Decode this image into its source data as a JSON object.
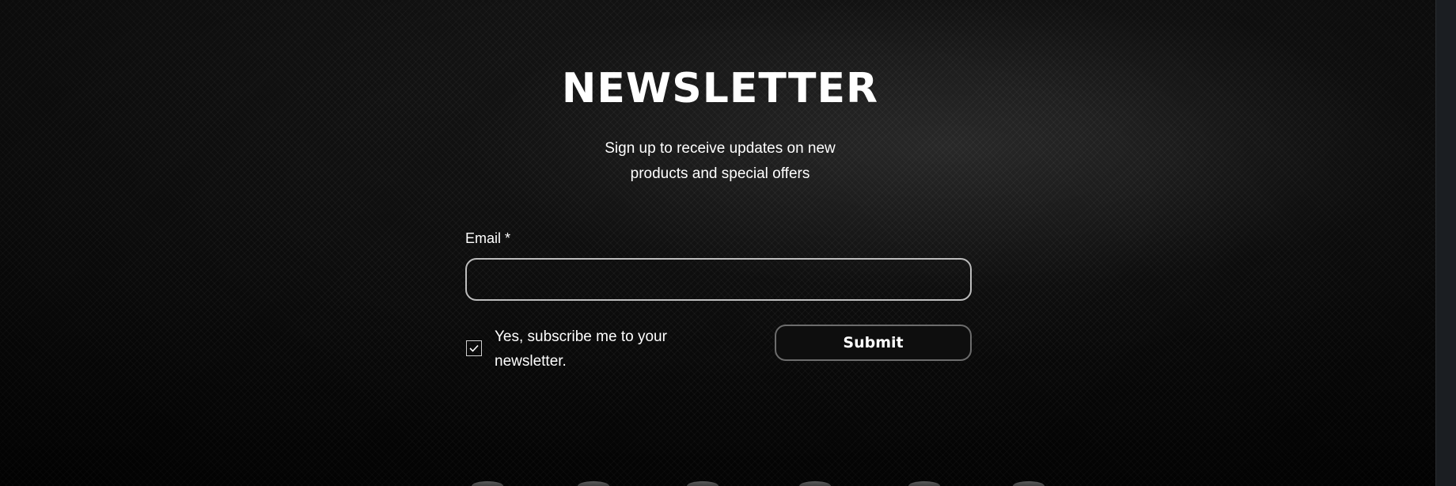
{
  "newsletter": {
    "title": "NEWSLETTER",
    "subtitle_line1": "Sign up to receive updates on new",
    "subtitle_line2": "products and special offers",
    "email_label": "Email *",
    "email_value": "",
    "email_placeholder": "",
    "checkbox_checked": true,
    "checkbox_label": "Yes, subscribe me to your newsletter.",
    "submit_label": "Submit"
  },
  "colors": {
    "background": "#0a0a0a",
    "text": "#ffffff",
    "input_border": "#bdbdbd",
    "button_border": "#6c6c6c",
    "button_bg": "#0e0e0e"
  },
  "icons": {
    "checkbox": "checkmark-icon"
  }
}
